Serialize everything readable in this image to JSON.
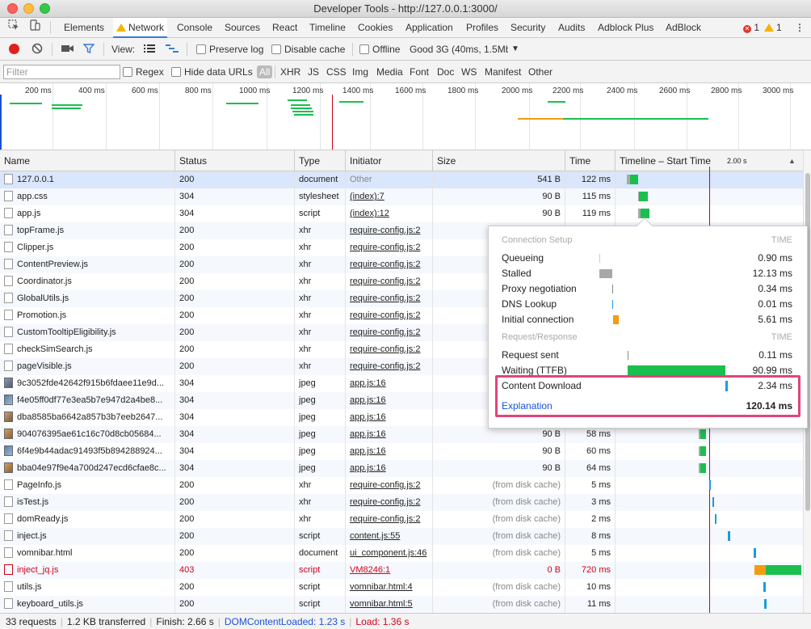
{
  "window": {
    "title": "Developer Tools - http://127.0.0.1:3000/"
  },
  "tabs": [
    "Elements",
    "Network",
    "Console",
    "Sources",
    "React",
    "Timeline",
    "Cookies",
    "Application",
    "Profiles",
    "Security",
    "Audits",
    "Adblock Plus",
    "AdBlock"
  ],
  "active_tab": "Network",
  "badges": {
    "errors": "1",
    "warnings": "1"
  },
  "toolbar": {
    "view_label": "View:",
    "preserve_log": "Preserve log",
    "disable_cache": "Disable cache",
    "offline": "Offline",
    "throttle": "Good 3G (40ms, 1.5Mb"
  },
  "filterbar": {
    "placeholder": "Filter",
    "regex": "Regex",
    "hide_data_urls": "Hide data URLs",
    "types": [
      "All",
      "XHR",
      "JS",
      "CSS",
      "Img",
      "Media",
      "Font",
      "Doc",
      "WS",
      "Manifest",
      "Other"
    ]
  },
  "overview_ticks": [
    "200 ms",
    "400 ms",
    "600 ms",
    "800 ms",
    "1000 ms",
    "1200 ms",
    "1400 ms",
    "1600 ms",
    "1800 ms",
    "2000 ms",
    "2200 ms",
    "2400 ms",
    "2600 ms",
    "2800 ms",
    "3000 ms"
  ],
  "columns": {
    "name": "Name",
    "status": "Status",
    "type": "Type",
    "initiator": "Initiator",
    "size": "Size",
    "time": "Time",
    "timeline": "Timeline – Start Time",
    "timeline_marker": "2.00 s"
  },
  "rows": [
    {
      "name": "127.0.0.1",
      "status": "200",
      "type": "document",
      "initiator": "Other",
      "size": "541 B",
      "time": "122 ms"
    },
    {
      "name": "app.css",
      "status": "304",
      "type": "stylesheet",
      "initiator": "(index):7",
      "size": "90 B",
      "time": "115 ms"
    },
    {
      "name": "app.js",
      "status": "304",
      "type": "script",
      "initiator": "(index):12",
      "size": "90 B",
      "time": "119 ms"
    },
    {
      "name": "topFrame.js",
      "status": "200",
      "type": "xhr",
      "initiator": "require-config.js:2",
      "size": "",
      "time": ""
    },
    {
      "name": "Clipper.js",
      "status": "200",
      "type": "xhr",
      "initiator": "require-config.js:2",
      "size": "",
      "time": ""
    },
    {
      "name": "ContentPreview.js",
      "status": "200",
      "type": "xhr",
      "initiator": "require-config.js:2",
      "size": "",
      "time": ""
    },
    {
      "name": "Coordinator.js",
      "status": "200",
      "type": "xhr",
      "initiator": "require-config.js:2",
      "size": "",
      "time": ""
    },
    {
      "name": "GlobalUtils.js",
      "status": "200",
      "type": "xhr",
      "initiator": "require-config.js:2",
      "size": "",
      "time": ""
    },
    {
      "name": "Promotion.js",
      "status": "200",
      "type": "xhr",
      "initiator": "require-config.js:2",
      "size": "",
      "time": ""
    },
    {
      "name": "CustomTooltipEligibility.js",
      "status": "200",
      "type": "xhr",
      "initiator": "require-config.js:2",
      "size": "",
      "time": ""
    },
    {
      "name": "checkSimSearch.js",
      "status": "200",
      "type": "xhr",
      "initiator": "require-config.js:2",
      "size": "",
      "time": ""
    },
    {
      "name": "pageVisible.js",
      "status": "200",
      "type": "xhr",
      "initiator": "require-config.js:2",
      "size": "",
      "time": ""
    },
    {
      "name": "9c3052fde42642f915b6fdaee11e9d...",
      "status": "304",
      "type": "jpeg",
      "initiator": "app.js:16",
      "size": "",
      "time": ""
    },
    {
      "name": "f4e05ff0df77e3ea5b7e947d2a4be8...",
      "status": "304",
      "type": "jpeg",
      "initiator": "app.js:16",
      "size": "",
      "time": ""
    },
    {
      "name": "dba8585ba6642a857b3b7eeb2647...",
      "status": "304",
      "type": "jpeg",
      "initiator": "app.js:16",
      "size": "",
      "time": ""
    },
    {
      "name": "904076395ae61c16c70d8cb05684...",
      "status": "304",
      "type": "jpeg",
      "initiator": "app.js:16",
      "size": "90 B",
      "time": "58 ms"
    },
    {
      "name": "6f4e9b44adac91493f5b894288924...",
      "status": "304",
      "type": "jpeg",
      "initiator": "app.js:16",
      "size": "90 B",
      "time": "60 ms"
    },
    {
      "name": "bba04e97f9e4a700d247ecd6cfae8c...",
      "status": "304",
      "type": "jpeg",
      "initiator": "app.js:16",
      "size": "90 B",
      "time": "64 ms"
    },
    {
      "name": "PageInfo.js",
      "status": "200",
      "type": "xhr",
      "initiator": "require-config.js:2",
      "size": "(from disk cache)",
      "time": "5 ms"
    },
    {
      "name": "isTest.js",
      "status": "200",
      "type": "xhr",
      "initiator": "require-config.js:2",
      "size": "(from disk cache)",
      "time": "3 ms"
    },
    {
      "name": "domReady.js",
      "status": "200",
      "type": "xhr",
      "initiator": "require-config.js:2",
      "size": "(from disk cache)",
      "time": "2 ms"
    },
    {
      "name": "inject.js",
      "status": "200",
      "type": "script",
      "initiator": "content.js:55",
      "size": "(from disk cache)",
      "time": "8 ms"
    },
    {
      "name": "vomnibar.html",
      "status": "200",
      "type": "document",
      "initiator": "ui_component.js:46",
      "size": "(from disk cache)",
      "time": "5 ms"
    },
    {
      "name": "inject_jq.js",
      "status": "403",
      "type": "script",
      "initiator": "VM8246:1",
      "size": "0 B",
      "time": "720 ms"
    },
    {
      "name": "utils.js",
      "status": "200",
      "type": "script",
      "initiator": "vomnibar.html:4",
      "size": "(from disk cache)",
      "time": "10 ms"
    },
    {
      "name": "keyboard_utils.js",
      "status": "200",
      "type": "script",
      "initiator": "vomnibar.html:5",
      "size": "(from disk cache)",
      "time": "11 ms"
    }
  ],
  "popover": {
    "connection_setup": "Connection Setup",
    "request_response": "Request/Response",
    "time_header": "TIME",
    "setup": [
      {
        "label": "Queueing",
        "value": "0.90 ms"
      },
      {
        "label": "Stalled",
        "value": "12.13 ms"
      },
      {
        "label": "Proxy negotiation",
        "value": "0.34 ms"
      },
      {
        "label": "DNS Lookup",
        "value": "0.01 ms"
      },
      {
        "label": "Initial connection",
        "value": "5.61 ms"
      }
    ],
    "response": [
      {
        "label": "Request sent",
        "value": "0.11 ms"
      },
      {
        "label": "Waiting (TTFB)",
        "value": "90.99 ms"
      },
      {
        "label": "Content Download",
        "value": "2.34 ms"
      }
    ],
    "explanation": "Explanation",
    "total": "120.14 ms"
  },
  "colors": {
    "waiting": "#1bbf4e",
    "download": "#1a9be0",
    "initial": "#f39c12",
    "stalled": "#a8a8a8",
    "highlight": "#e0457b",
    "active_tab": "#3879d9",
    "dcl": "#1a52d6",
    "load": "#d0021b"
  },
  "status": {
    "requests": "33 requests",
    "transferred": "1.2 KB transferred",
    "finish": "Finish: 2.66 s",
    "dcl": "DOMContentLoaded: 1.23 s",
    "load": "Load: 1.36 s"
  }
}
